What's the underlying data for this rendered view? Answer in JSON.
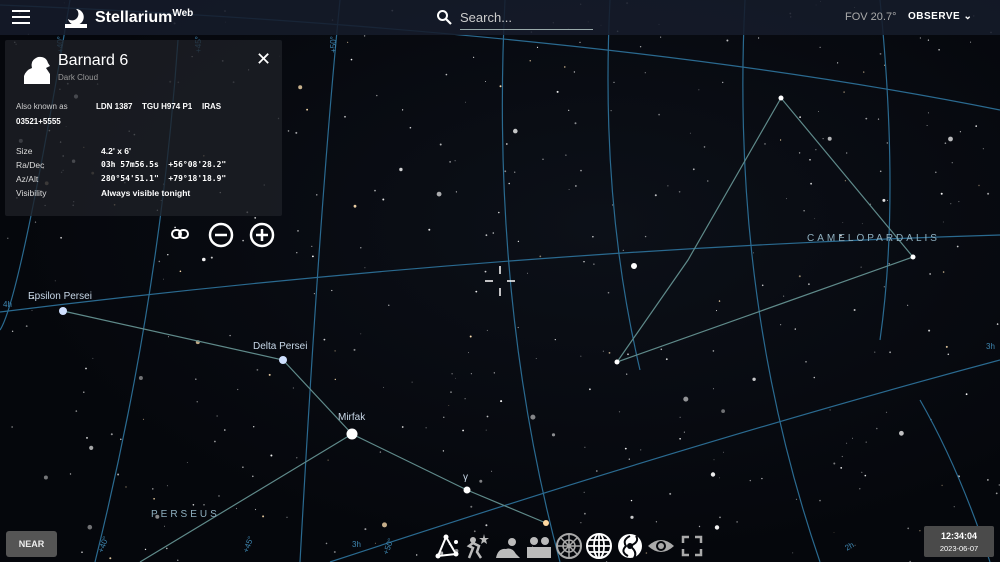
{
  "header": {
    "app_name": "Stellarium",
    "app_suffix": "Web",
    "search_placeholder": "Search...",
    "fov": "FOV 20.7°",
    "observe_label": "OBSERVE"
  },
  "info_panel": {
    "title": "Barnard 6",
    "type": "Dark Cloud",
    "aka_label": "Also known as",
    "aka": [
      "LDN 1387",
      "TGU H974 P1",
      "IRAS",
      "03521+5555"
    ],
    "rows": [
      {
        "label": "Size",
        "value": "4.2' x 6'"
      },
      {
        "label": "Ra/Dec",
        "value": "03h 57m56.5s  +56°08'28.2\""
      },
      {
        "label": "Az/Alt",
        "value": "280°54'51.1\"  +79°18'18.9\""
      },
      {
        "label": "Visibility",
        "value": "Always visible tonight"
      }
    ]
  },
  "sky": {
    "stars": [
      "Epsilon Persei",
      "Delta Persei",
      "Mirfak",
      "γ"
    ],
    "constellations": [
      "CAMELOPARDALIS",
      "PERSEUS"
    ],
    "grid_labels": [
      "4h",
      "3h",
      "3h",
      "2h",
      "+40°",
      "+45°",
      "+50°",
      "+40°",
      "+45°",
      "+50°"
    ]
  },
  "near_label": "NEAR",
  "clock": {
    "time": "12:34:04",
    "date": "2023-06-07"
  },
  "colors": {
    "grid": "#2f6f94",
    "constellation": "#5f8a8a",
    "panel": "#1e2026"
  }
}
